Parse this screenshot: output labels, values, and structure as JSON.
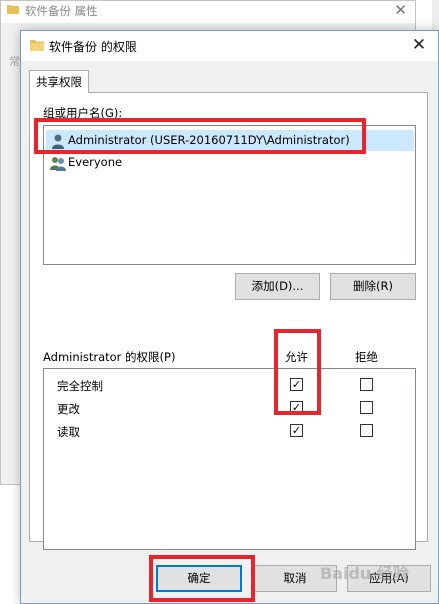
{
  "background_window": {
    "title": "软件备份 属性",
    "ghost_text": "常"
  },
  "dialog": {
    "title": "软件备份 的权限",
    "close_glyph": "✕",
    "tab_label": "共享权限",
    "group_label": "组或用户名(G):",
    "users": [
      {
        "name": "Administrator (USER-20160711DY\\Administrator)",
        "selected": true
      },
      {
        "name": "Everyone",
        "selected": false
      }
    ],
    "add_button": "添加(D)...",
    "remove_button": "删除(R)",
    "permissions_label": "Administrator 的权限(P)",
    "allow_header": "允许",
    "deny_header": "拒绝",
    "permissions": [
      {
        "name": "完全控制",
        "allow": true,
        "deny": false
      },
      {
        "name": "更改",
        "allow": true,
        "deny": false
      },
      {
        "name": "读取",
        "allow": true,
        "deny": false
      }
    ],
    "ok_button": "确定",
    "cancel_button": "取消",
    "apply_button": "应用(A)"
  },
  "watermark": "Baidu 经验",
  "colors": {
    "highlight": "#e8242c",
    "selection": "#cce8ff",
    "focus_border": "#0078d7"
  }
}
